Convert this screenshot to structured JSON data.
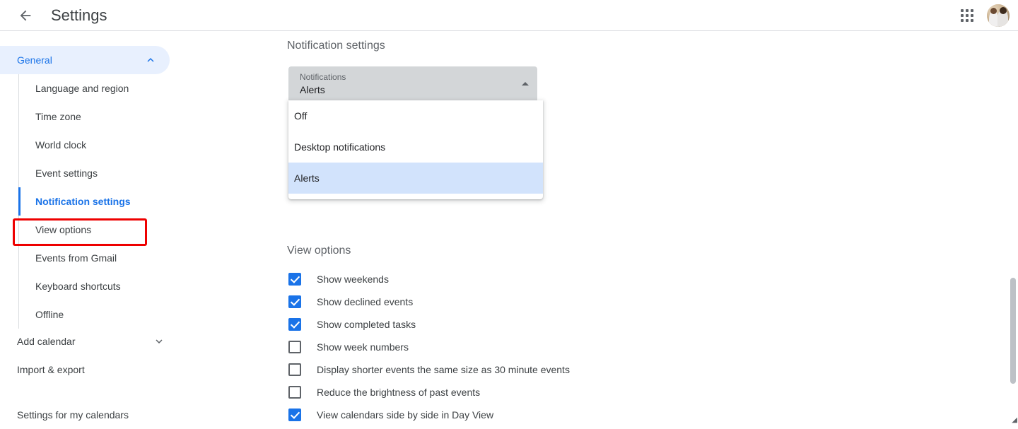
{
  "header": {
    "back_icon": "back-arrow-icon",
    "title": "Settings",
    "apps_icon": "apps-grid-icon",
    "avatar_icon": "user-avatar"
  },
  "sidebar": {
    "section": {
      "label": "General",
      "chevron": "chevron-up-icon",
      "expanded": true
    },
    "subitems": [
      {
        "label": "Language and region",
        "active": false
      },
      {
        "label": "Time zone",
        "active": false
      },
      {
        "label": "World clock",
        "active": false
      },
      {
        "label": "Event settings",
        "active": false
      },
      {
        "label": "Notification settings",
        "active": true
      },
      {
        "label": "View options",
        "active": false
      },
      {
        "label": "Events from Gmail",
        "active": false
      },
      {
        "label": "Keyboard shortcuts",
        "active": false
      },
      {
        "label": "Offline",
        "active": false
      }
    ],
    "root_items": [
      {
        "label": "Add calendar",
        "chevron": "chevron-down-icon"
      },
      {
        "label": "Import & export",
        "chevron": ""
      },
      {
        "label": "Settings for my calendars",
        "chevron": ""
      }
    ]
  },
  "main": {
    "notification_settings": {
      "title": "Notification settings",
      "select": {
        "label": "Notifications",
        "value": "Alerts",
        "arrow_icon": "triangle-up-icon",
        "open": true,
        "options": [
          "Off",
          "Desktop notifications",
          "Alerts"
        ],
        "selected_option": "Alerts"
      }
    },
    "view_options": {
      "title": "View options",
      "checkboxes": [
        {
          "label": "Show weekends",
          "checked": true
        },
        {
          "label": "Show declined events",
          "checked": true
        },
        {
          "label": "Show completed tasks",
          "checked": true
        },
        {
          "label": "Show week numbers",
          "checked": false
        },
        {
          "label": "Display shorter events the same size as 30 minute events",
          "checked": false
        },
        {
          "label": "Reduce the brightness of past events",
          "checked": false
        },
        {
          "label": "View calendars side by side in Day View",
          "checked": true
        }
      ]
    }
  },
  "colors": {
    "accent": "#1a73e8",
    "accent_light": "#e8f0fe",
    "menu_selected": "#d2e3fc",
    "highlight_box": "#ee0000",
    "text_primary": "#3c4043",
    "text_secondary": "#5f6368",
    "field_bg": "#d3d6d8"
  },
  "scrollbar": {
    "name": "vertical-scrollbar"
  }
}
